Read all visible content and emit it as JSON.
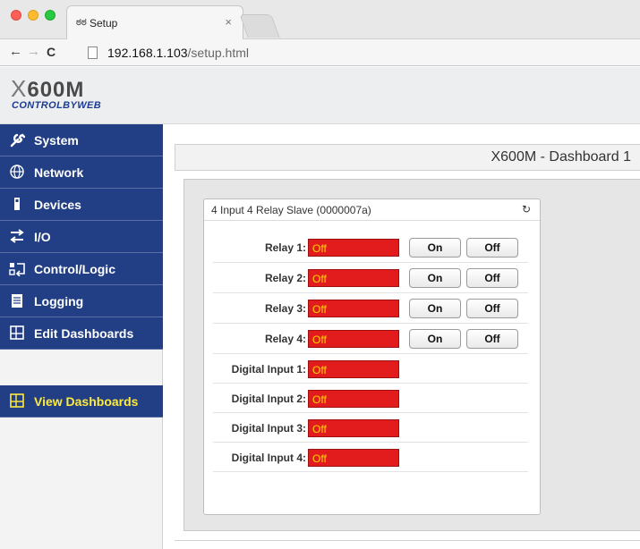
{
  "browser": {
    "tab_title": "Setup",
    "tab_favicon": "ಠಠ",
    "tab_close": "×",
    "url_host": "192.168.1.103",
    "url_path": "/setup.html",
    "back": "←",
    "forward": "→",
    "reload": "C"
  },
  "header": {
    "logo_model": "600M",
    "logo_x": "X",
    "logo_brand": "CONTROLBYWEB"
  },
  "sidebar": {
    "items": [
      {
        "label": "System",
        "icon": "wrench-icon"
      },
      {
        "label": "Network",
        "icon": "globe-icon"
      },
      {
        "label": "Devices",
        "icon": "device-icon"
      },
      {
        "label": "I/O",
        "icon": "arrows-icon"
      },
      {
        "label": "Control/Logic",
        "icon": "control-logic-icon"
      },
      {
        "label": "Logging",
        "icon": "log-icon"
      },
      {
        "label": "Edit Dashboards",
        "icon": "dashboard-icon"
      }
    ],
    "view_dashboards": {
      "label": "View Dashboards",
      "icon": "dashboard-icon",
      "color": "#ffeb3b"
    }
  },
  "main": {
    "title": "X600M - Dashboard 1",
    "widget": {
      "title": "4 Input 4 Relay Slave (0000007a)",
      "refresh_glyph": "↻",
      "relays": [
        {
          "label": "Relay 1:",
          "state": "Off",
          "on_label": "On",
          "off_label": "Off"
        },
        {
          "label": "Relay 2:",
          "state": "Off",
          "on_label": "On",
          "off_label": "Off"
        },
        {
          "label": "Relay 3:",
          "state": "Off",
          "on_label": "On",
          "off_label": "Off"
        },
        {
          "label": "Relay 4:",
          "state": "Off",
          "on_label": "On",
          "off_label": "Off"
        }
      ],
      "inputs": [
        {
          "label": "Digital Input 1:",
          "state": "Off"
        },
        {
          "label": "Digital Input 2:",
          "state": "Off"
        },
        {
          "label": "Digital Input 3:",
          "state": "Off"
        },
        {
          "label": "Digital Input 4:",
          "state": "Off"
        }
      ]
    }
  },
  "colors": {
    "nav_bg": "#223f85",
    "state_off_bg": "#e21c1c",
    "state_text": "#ffd400",
    "brand": "#1d3c8f"
  }
}
